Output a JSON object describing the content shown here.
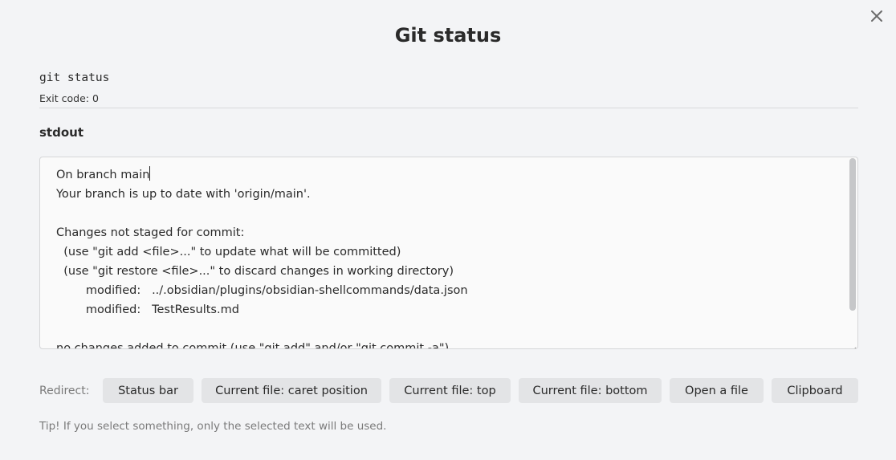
{
  "modal": {
    "title": "Git status",
    "close_icon": "close-icon"
  },
  "command": {
    "text": "git status",
    "exit_code": "Exit code: 0"
  },
  "stdout": {
    "label": "stdout",
    "first_line": "On branch main",
    "rest": "\nYour branch is up to date with 'origin/main'.\n\nChanges not staged for commit:\n  (use \"git add <file>...\" to update what will be committed)\n  (use \"git restore <file>...\" to discard changes in working directory)\n        modified:   ../.obsidian/plugins/obsidian-shellcommands/data.json\n        modified:   TestResults.md\n\nno changes added to commit (use \"git add\" and/or \"git commit -a\")"
  },
  "redirect": {
    "label": "Redirect:",
    "buttons": [
      "Status bar",
      "Current file: caret position",
      "Current file: top",
      "Current file: bottom",
      "Open a file",
      "Clipboard"
    ]
  },
  "tip": "Tip! If you select something, only the selected text will be used.",
  "colors": {
    "background": "#f3f4f6",
    "button_bg": "#e3e4e6",
    "textarea_bg": "#fafafa",
    "muted_text": "#7a7a7a"
  }
}
